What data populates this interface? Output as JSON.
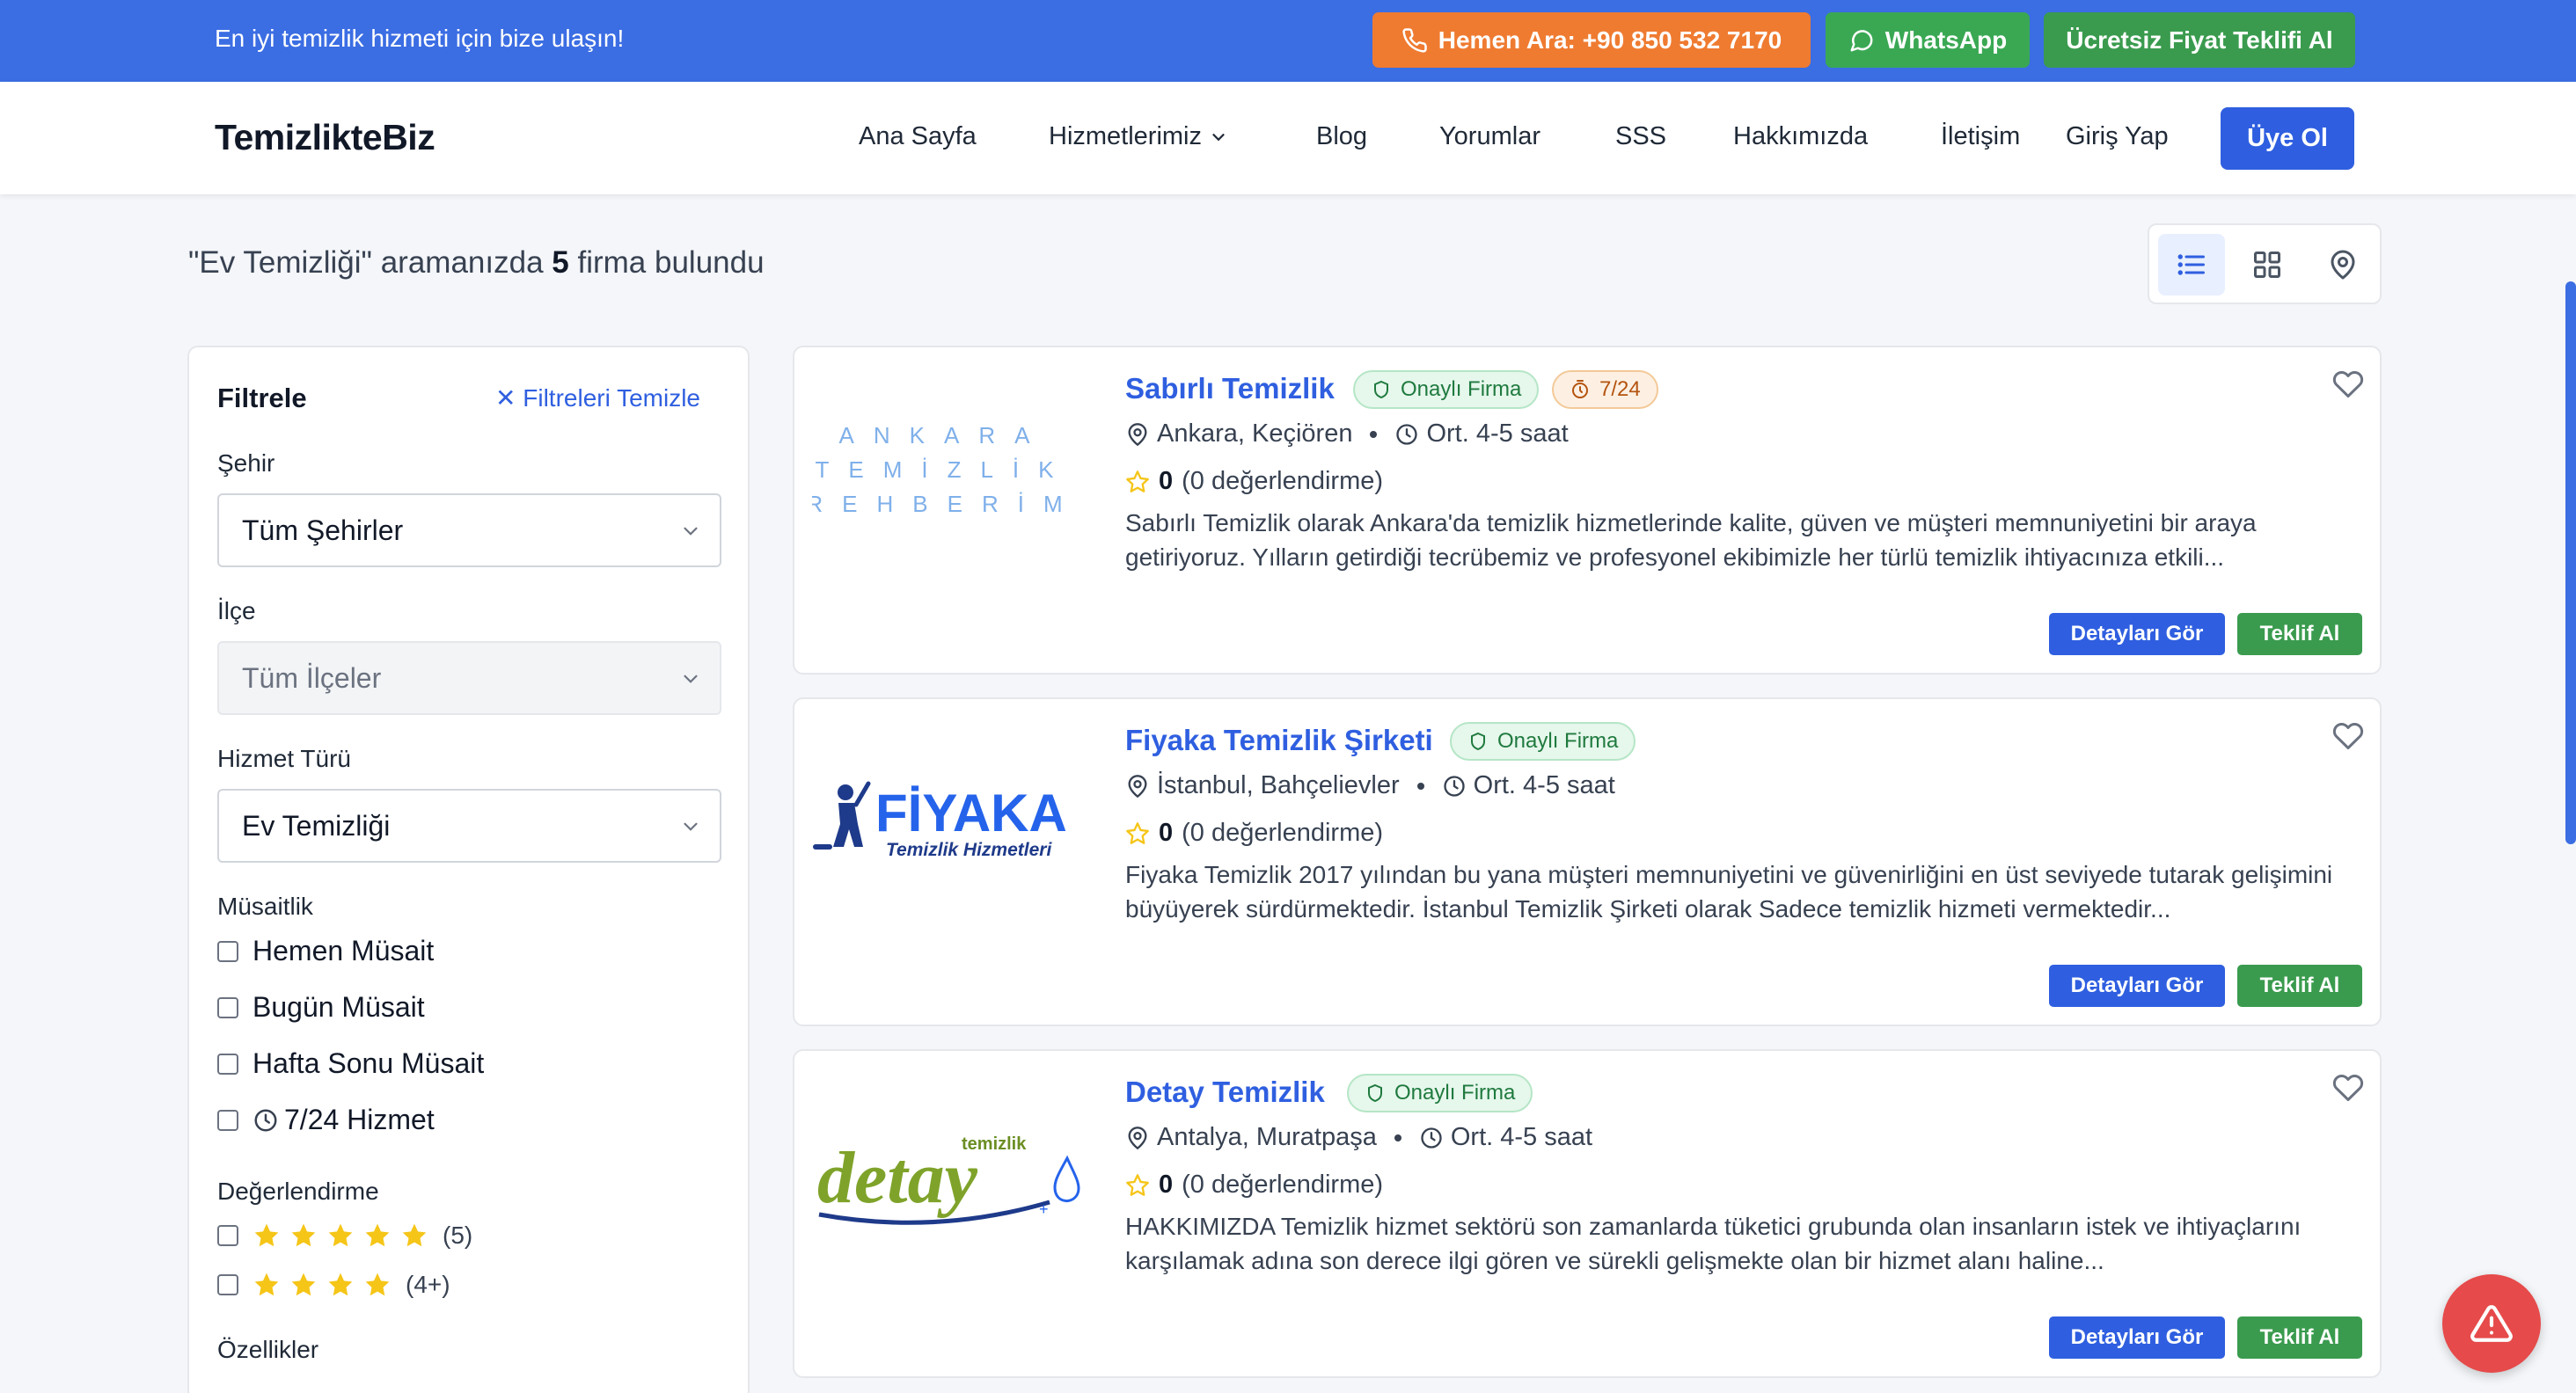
{
  "topbar": {
    "message": "En iyi temizlik hizmeti için bize ulaşın!",
    "call_label": "Hemen Ara: +90 850 532 7170",
    "whatsapp_label": "WhatsApp",
    "quote_label": "Ücretsiz Fiyat Teklifi Al"
  },
  "nav": {
    "brand": "TemizlikteBiz",
    "items": [
      "Ana Sayfa",
      "Hizmetlerimiz",
      "Blog",
      "Yorumlar",
      "SSS",
      "Hakkımızda",
      "İletişim",
      "Giriş Yap"
    ],
    "register_label": "Üye Ol"
  },
  "results": {
    "query": "\"Ev Temizliği\"",
    "prefix_text": "aramanızda",
    "count": "5",
    "suffix_text": "firma bulundu"
  },
  "filters": {
    "title": "Filtrele",
    "clear_label": "Filtreleri Temizle",
    "city_label": "Şehir",
    "city_value": "Tüm Şehirler",
    "district_label": "İlçe",
    "district_value": "Tüm İlçeler",
    "service_label": "Hizmet Türü",
    "service_value": "Ev Temizliği",
    "availability_label": "Müsaitlik",
    "availability_options": [
      "Hemen Müsait",
      "Bugün Müsait",
      "Hafta Sonu Müsait",
      "7/24 Hizmet"
    ],
    "rating_label": "Değerlendirme",
    "rating_options": [
      {
        "stars": 5,
        "text": "(5)"
      },
      {
        "stars": 4,
        "text": "(4+)"
      }
    ],
    "features_label": "Özellikler"
  },
  "companies": [
    {
      "name": "Sabırlı Temizlik",
      "badge": "Onaylı Firma",
      "extra_badge": "7/24",
      "location": "Ankara, Keçiören",
      "duration": "Ort. 4-5 saat",
      "rating": "0",
      "reviews": "(0 değerlendirme)",
      "description": "Sabırlı Temizlik olarak Ankara'da temizlik hizmetlerinde kalite, güven ve müşteri memnuniyetini bir araya getiriyoruz. Yılların getirdiği tecrübemiz ve profesyonel ekibimizle her türlü temizlik ihtiyacınıza etkili...",
      "logo_lines": [
        "ANKARA",
        "TEMİZLİK",
        "REHBERİM"
      ]
    },
    {
      "name": "Fiyaka Temizlik Şirketi",
      "badge": "Onaylı Firma",
      "location": "İstanbul, Bahçelievler",
      "duration": "Ort. 4-5 saat",
      "rating": "0",
      "reviews": "(0 değerlendirme)",
      "description": "Fiyaka Temizlik 2017 yılından bu yana müşteri memnuniyetini ve güvenirliğini en üst seviyede tutarak gelişimini büyüyerek sürdürmektedir. İstanbul Temizlik Şirketi olarak Sadece temizlik hizmeti vermektedir...",
      "logo_title": "FİYAKA",
      "logo_sub": "Temizlik Hizmetleri"
    },
    {
      "name": "Detay Temizlik",
      "badge": "Onaylı Firma",
      "location": "Antalya, Muratpaşa",
      "duration": "Ort. 4-5 saat",
      "rating": "0",
      "reviews": "(0 değerlendirme)",
      "description": "HAKKIMIZDA Temizlik hizmet sektörü son zamanlarda tüketici grubunda olan insanların istek ve ihtiyaçlarını karşılamak adına son derece ilgi gören ve sürekli gelişmekte olan bir hizmet alanı haline...",
      "logo_small": "temizlik",
      "logo_big": "detay"
    }
  ],
  "card_actions": {
    "details_label": "Detayları Gör",
    "offer_label": "Teklif Al"
  },
  "colors": {
    "primary": "#2f5fe0",
    "banner": "#3b6de3",
    "call": "#ef7b31",
    "green": "#3a9b4e",
    "alert": "#e64a4a"
  }
}
